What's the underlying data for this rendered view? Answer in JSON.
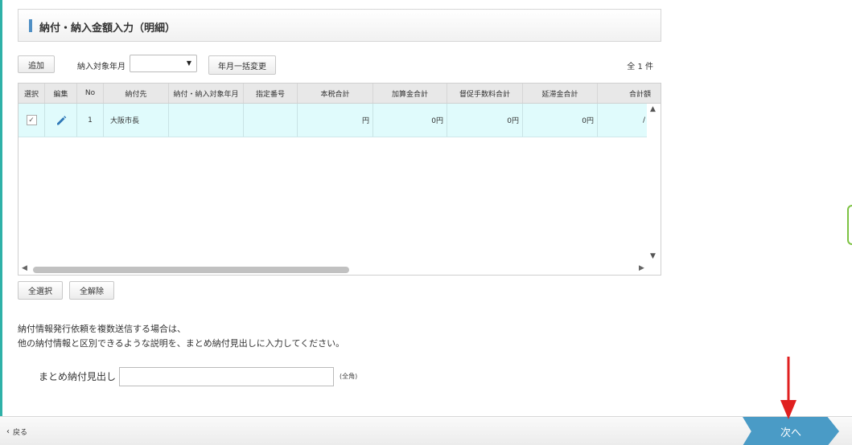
{
  "section": {
    "title": "納付・納入金額入力（明細）"
  },
  "toolbar": {
    "add_label": "追加",
    "period_label": "納入対象年月",
    "period_value": "",
    "bulk_change_label": "年月一括変更",
    "total_count": "全 1 件"
  },
  "grid": {
    "columns": [
      "選択",
      "編集",
      "No",
      "納付先",
      "納付・納入対象年月",
      "指定番号",
      "本税合計",
      "加算金合計",
      "督促手数料合計",
      "延滞金合計",
      "合計額"
    ],
    "rows": [
      {
        "selected_mark": "✓",
        "no": "1",
        "payee": "大阪市長",
        "target_period": "",
        "designation_no": "",
        "principal_total": "円",
        "additional_total": "0円",
        "dunning_fee_total": "0円",
        "delinquency_total": "0円",
        "grand_total": "/"
      }
    ]
  },
  "grid_actions": {
    "select_all": "全選択",
    "deselect_all": "全解除"
  },
  "description": {
    "line1": "納付情報発行依頼を複数送信する場合は、",
    "line2": "他の納付情報と区別できるような説明を、まとめ納付見出しに入力してください。"
  },
  "summary_field": {
    "label": "まとめ納付見出し",
    "value": "",
    "hint": "(全角)"
  },
  "footer": {
    "back_label": "戻る",
    "next_label": "次へ"
  },
  "colors": {
    "next_button": "#4a9bc6",
    "row_highlight": "#e0fbfc",
    "annotation_arrow": "#e02020"
  }
}
